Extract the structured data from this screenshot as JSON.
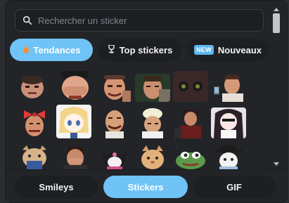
{
  "search": {
    "placeholder": "Rechercher un sticker",
    "icon": "search-icon"
  },
  "top_tabs": [
    {
      "label": "Tendances",
      "icon": "flame-icon",
      "active": true
    },
    {
      "label": "Top stickers",
      "icon": "trophy-icon",
      "active": false
    },
    {
      "label": "Nouveaux",
      "badge": "NEW",
      "active": false
    }
  ],
  "stickers": [
    "man-face-sticker",
    "man-laughing-sticker",
    "meme-man-sticker",
    "man-smirk-sticker",
    "cat-eyes-sticker",
    "man-phone-sticker",
    "man-bow-sticker",
    "anime-girl-sticker",
    "el-risitas-sticker",
    "chef-sticker",
    "man-sitting-sticker",
    "anime-girl-peace-sticker",
    "cat-sticker",
    "man-facepalm-sticker",
    "kuromi-sticker",
    "orange-cat-sticker",
    "pepe-sticker",
    "hat-character-sticker"
  ],
  "bottom_tabs": [
    {
      "label": "Smileys",
      "active": false
    },
    {
      "label": "Stickers",
      "active": true
    },
    {
      "label": "GIF",
      "active": false
    }
  ],
  "colors": {
    "accent": "#6fc3f6",
    "panel": "#232428",
    "pill": "#1e1f22"
  }
}
